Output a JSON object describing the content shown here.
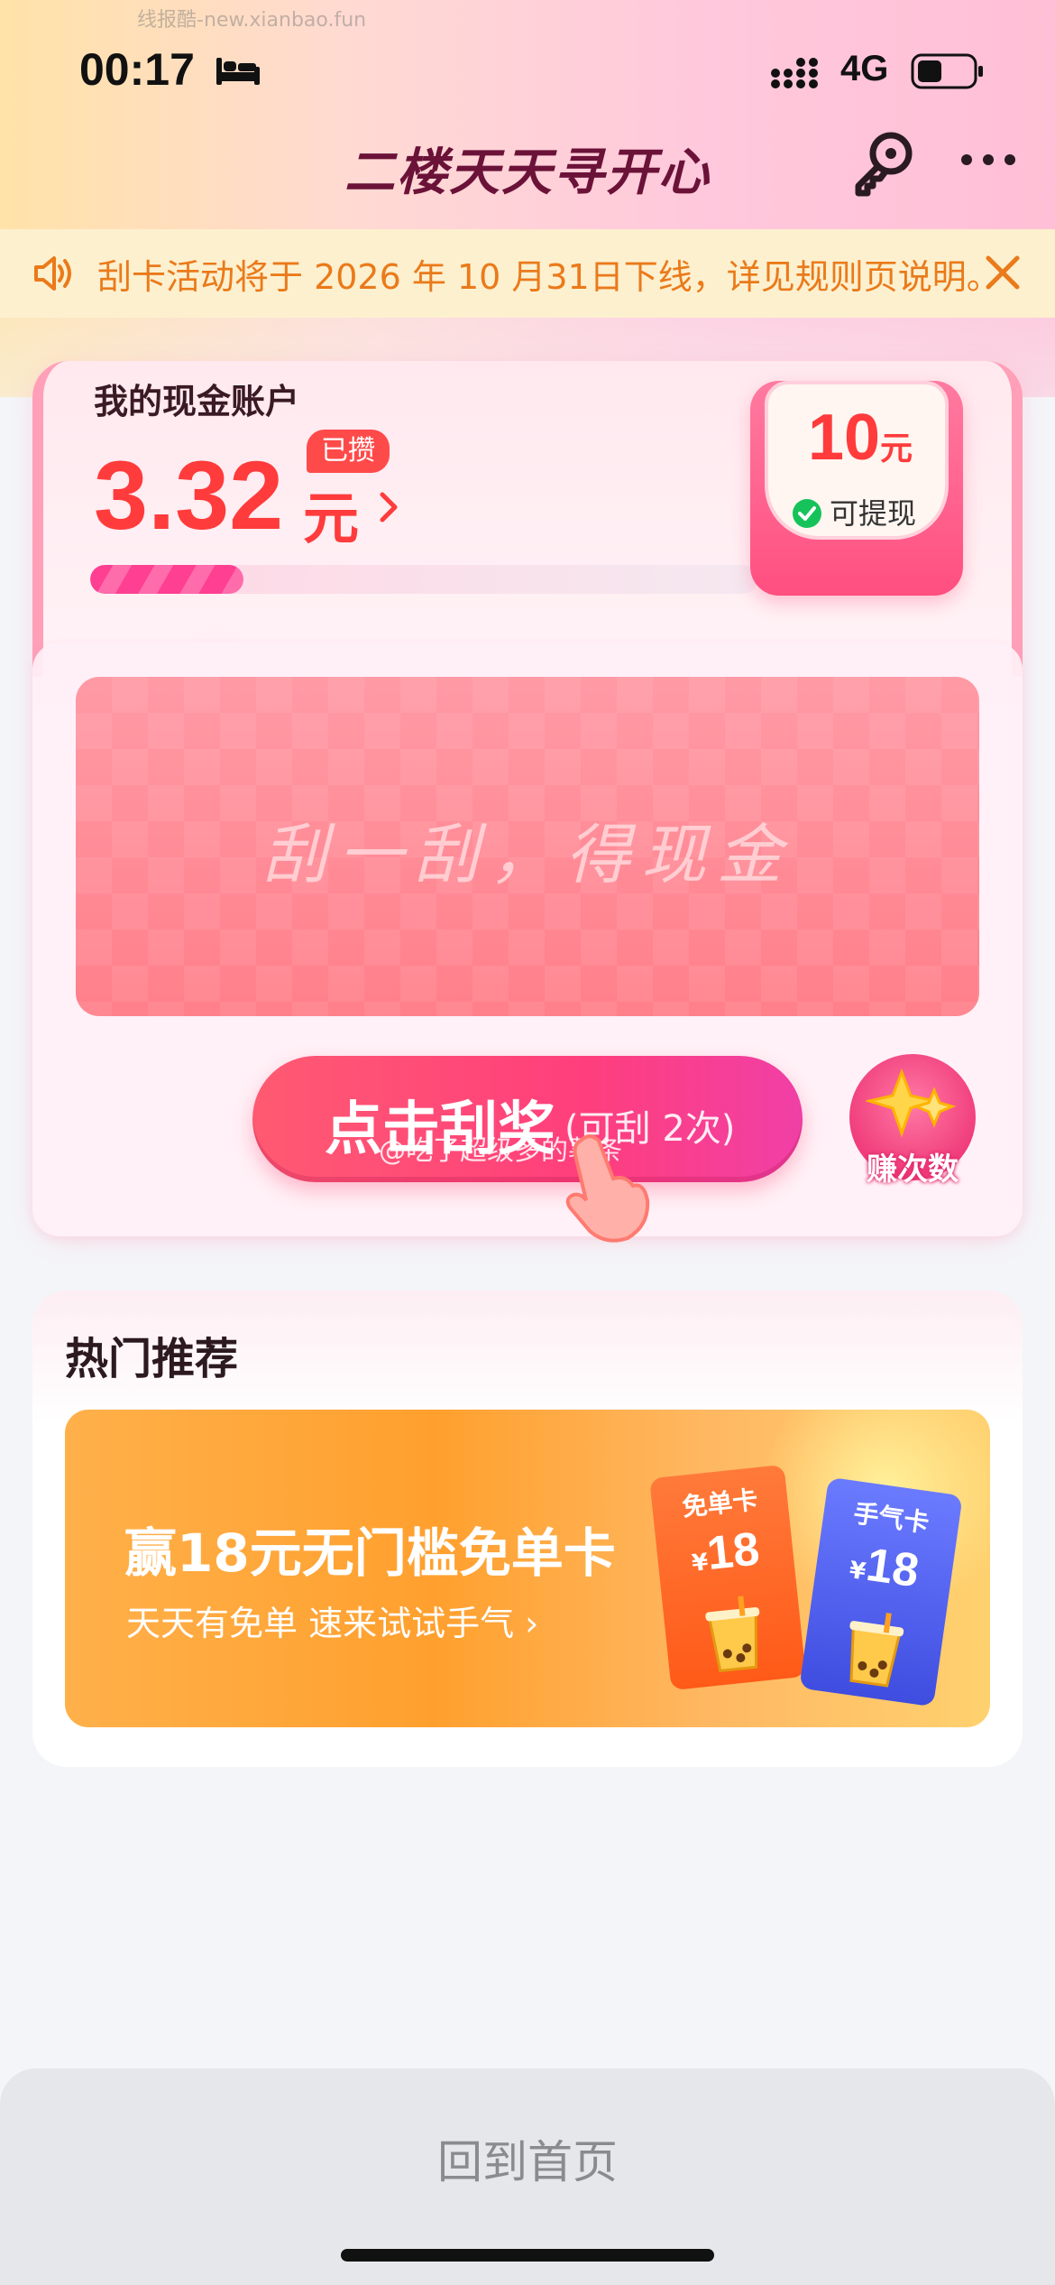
{
  "watermark_top": "线报酷-new.xianbao.fun",
  "status": {
    "time": "00:17",
    "network": "4G"
  },
  "nav": {
    "title": "二楼天天寻开心"
  },
  "notice": {
    "text": "刮卡活动将于 2026 年 10 月31日下线，详见规则页说明。"
  },
  "account": {
    "label": "我的现金账户",
    "badge": "已攒",
    "amount": "3.32",
    "unit": "元",
    "progress_fraction": 0.23,
    "cashout": {
      "amount": "10",
      "unit": "元",
      "label": "可提现"
    }
  },
  "scratch": {
    "placeholder": "刮一刮，得现金",
    "button_label": "点击刮奖",
    "button_sub": "(可刮 2次)",
    "earn_label": "赚次数"
  },
  "watermark_mid": "@吃了超级多的薯条",
  "hot": {
    "title": "热门推荐",
    "promo_title": "赢18元无门槛免单卡",
    "promo_sub": "天天有免单  速来试试手气 ›",
    "tickets": [
      {
        "head": "免单卡",
        "currency": "¥",
        "value": "18"
      },
      {
        "head": "手气卡",
        "currency": "¥",
        "value": "18"
      }
    ]
  },
  "bottom": {
    "home_label": "回到首页"
  },
  "colors": {
    "accent": "#ff3b3b",
    "notice_text": "#ea7a1a",
    "title": "#6b1238"
  }
}
